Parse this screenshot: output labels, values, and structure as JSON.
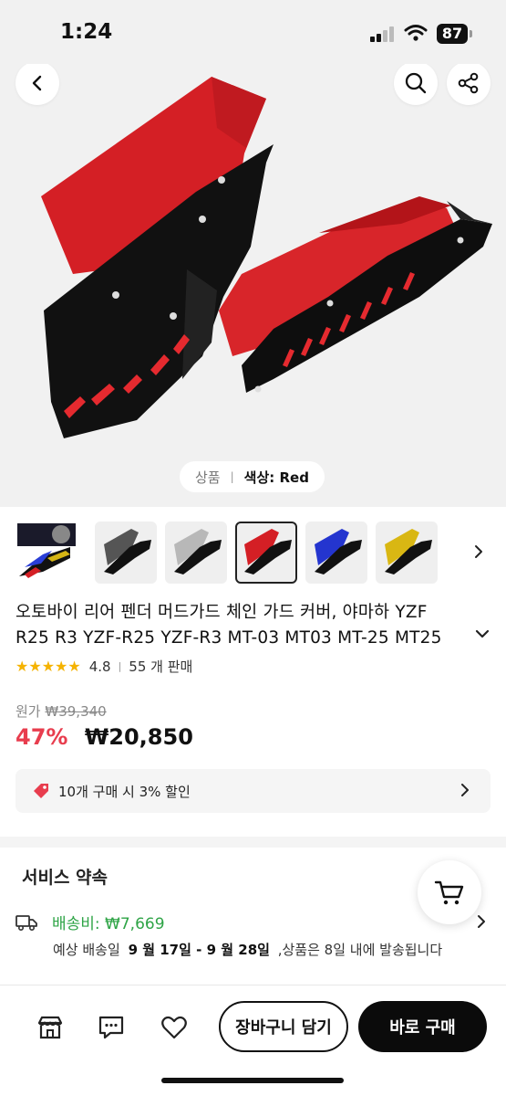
{
  "status_bar": {
    "time": "1:24",
    "battery": "87"
  },
  "variant_pill": {
    "label": "상품",
    "option_label": "색상: Red"
  },
  "product": {
    "title_line1": "오토바이 리어 펜더 머드가드 체인 가드 커버, 야마하 YZF",
    "title_line2": "R25 R3 YZF-R25 YZF-R3 MT-03 MT03 MT-25 MT25",
    "rating": "4.8",
    "sold": "55 개 판매",
    "original_price_label": "원가",
    "original_price": "₩39,340",
    "discount": "47%",
    "sale_price": "₩20,850"
  },
  "coupon": {
    "text": "10개 구매 시 3% 할인"
  },
  "service": {
    "title": "서비스 약속",
    "shipping_fee": "배송비: ₩7,669",
    "est_label": "예상 배송일",
    "est_dates": "9 월 17일 - 9 월 28일",
    "ship_note": ",상품은 8일 내에 발송됩니다"
  },
  "bottom": {
    "cart_button": "장바구니 담기",
    "buy_button": "바로 구매"
  },
  "thumbnails": [
    {
      "color": "multi"
    },
    {
      "color": "black"
    },
    {
      "color": "silver"
    },
    {
      "color": "red",
      "selected": true
    },
    {
      "color": "blue"
    },
    {
      "color": "yellow"
    }
  ],
  "colors": {
    "accent_red": "#e83d4e",
    "shipping_green": "#2ea446",
    "star": "#f5b301"
  },
  "icons": [
    "back-icon",
    "search-icon",
    "share-icon",
    "chevron-right-icon",
    "chevron-down-icon",
    "tag-icon",
    "truck-icon",
    "cart-icon",
    "store-icon",
    "chat-icon",
    "heart-icon"
  ]
}
